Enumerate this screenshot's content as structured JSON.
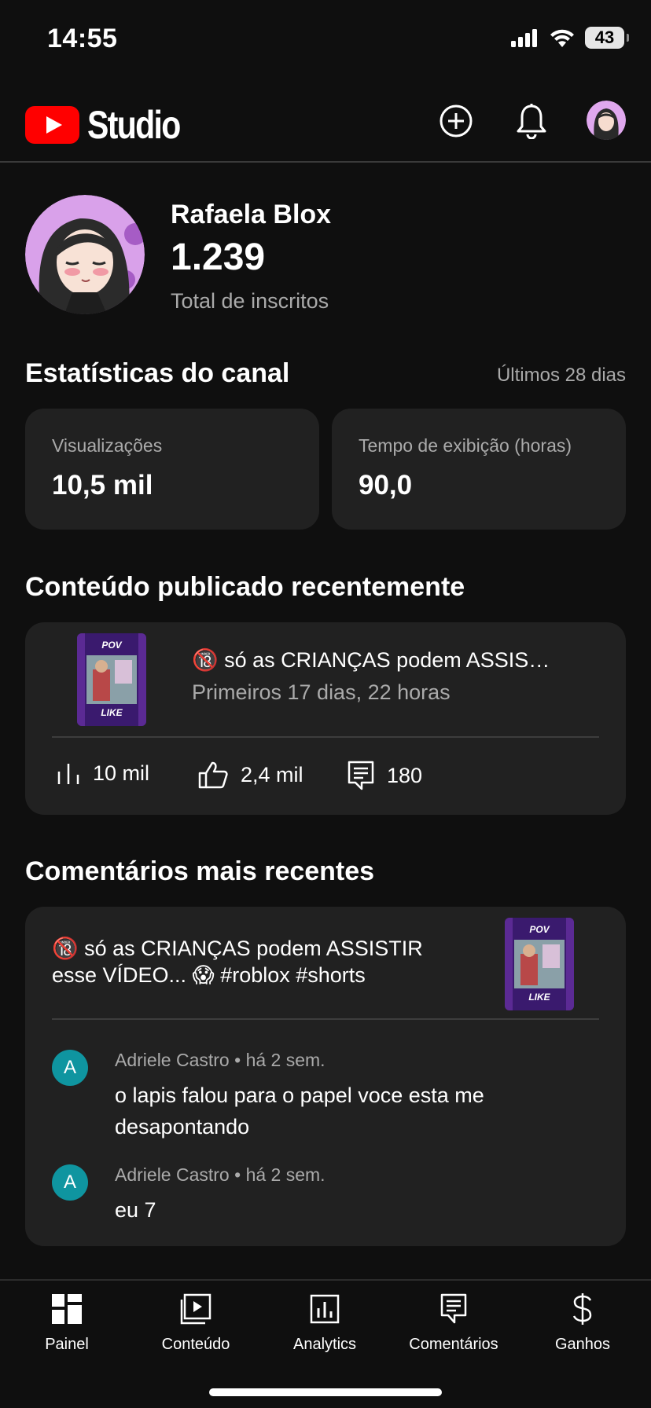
{
  "status_bar": {
    "time": "14:55",
    "battery": "43"
  },
  "header": {
    "logo_text": "Studio"
  },
  "channel": {
    "name": "Rafaela Blox",
    "subscribers": "1.239",
    "subscribers_label": "Total de inscritos"
  },
  "stats": {
    "title": "Estatísticas do canal",
    "period": "Últimos 28 dias",
    "cards": [
      {
        "label": "Visualizações",
        "value": "10,5 mil"
      },
      {
        "label": "Tempo de exibição (horas)",
        "value": "90,0"
      }
    ]
  },
  "recent_content": {
    "title": "Conteúdo publicado recentemente",
    "video_title": "🔞 só as CRIANÇAS podem ASSISTIR esse VÍDEO... 😱 #roblox #shorts",
    "period": "Primeiros 17 dias, 22 horas",
    "thumb_top": "POV",
    "thumb_bottom": "LIKE",
    "metrics": {
      "views": "10 mil",
      "likes": "2,4 mil",
      "comments": "180"
    }
  },
  "recent_comments": {
    "title": "Comentários mais recentes",
    "video_title": "🔞 só as CRIANÇAS podem ASSISTIR esse VÍDEO... 😱 #roblox #shorts",
    "thumb_top": "POV",
    "thumb_bottom": "LIKE",
    "comments": [
      {
        "initial": "A",
        "author": "Adriele Castro",
        "time": "há 2 sem.",
        "text": "o lapis falou para o papel voce esta me desapontando"
      },
      {
        "initial": "A",
        "author": "Adriele Castro",
        "time": "há 2 sem.",
        "text": "eu 7"
      }
    ]
  },
  "nav": [
    {
      "label": "Painel",
      "icon": "dashboard-icon"
    },
    {
      "label": "Conteúdo",
      "icon": "content-icon"
    },
    {
      "label": "Analytics",
      "icon": "analytics-icon"
    },
    {
      "label": "Comentários",
      "icon": "comments-icon"
    },
    {
      "label": "Ganhos",
      "icon": "dollar-icon"
    }
  ],
  "colors": {
    "background": "#0f0f0f",
    "card": "#212121",
    "brand_red": "#ff0000",
    "avatar_teal": "#0f95a0",
    "muted_text": "#aaaaaa"
  }
}
